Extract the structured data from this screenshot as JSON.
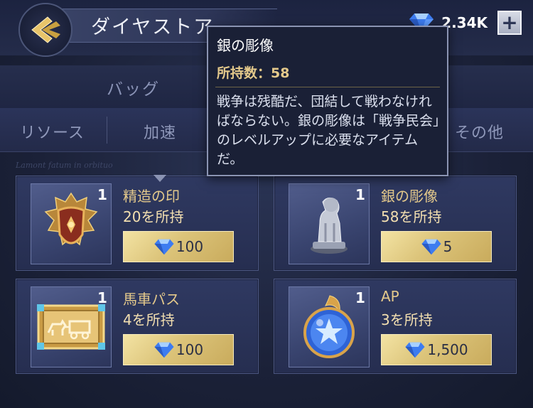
{
  "header": {
    "title": "ダイヤストア",
    "currency_icon": "diamond-icon",
    "currency_value": "2.34K",
    "plus_label": "+"
  },
  "tabs": {
    "main": [
      {
        "label": "バッグ"
      }
    ],
    "sub": [
      {
        "label": "リソース"
      },
      {
        "label": "加速"
      },
      {
        "label": "その他"
      }
    ]
  },
  "background_text": "Lamont fatum in orbituo",
  "items": [
    {
      "qty": "1",
      "name": "精造の印",
      "owned": "20を所持",
      "price": "100",
      "icon": "crest-shield-icon"
    },
    {
      "qty": "1",
      "name": "銀の彫像",
      "owned": "58を所持",
      "price": "5",
      "icon": "silver-lion-statue-icon"
    },
    {
      "qty": "1",
      "name": "馬車パス",
      "owned": "4を所持",
      "price": "100",
      "icon": "carriage-pass-icon"
    },
    {
      "qty": "1",
      "name": "AP",
      "owned": "3を所持",
      "price": "1,500",
      "icon": "ap-orb-icon"
    }
  ],
  "tooltip": {
    "title": "銀の彫像",
    "count_label": "所持数：",
    "count_value": "58",
    "description": "戦争は残酷だ、団結して戦わなければならない。銀の彫像は「戦争民会」のレベルアップに必要なアイテムだ。"
  },
  "colors": {
    "accent_gold": "#e4c98b",
    "background": "#1b2138",
    "price_button": "#dcc47a",
    "diamond": "#3d7cf0"
  }
}
